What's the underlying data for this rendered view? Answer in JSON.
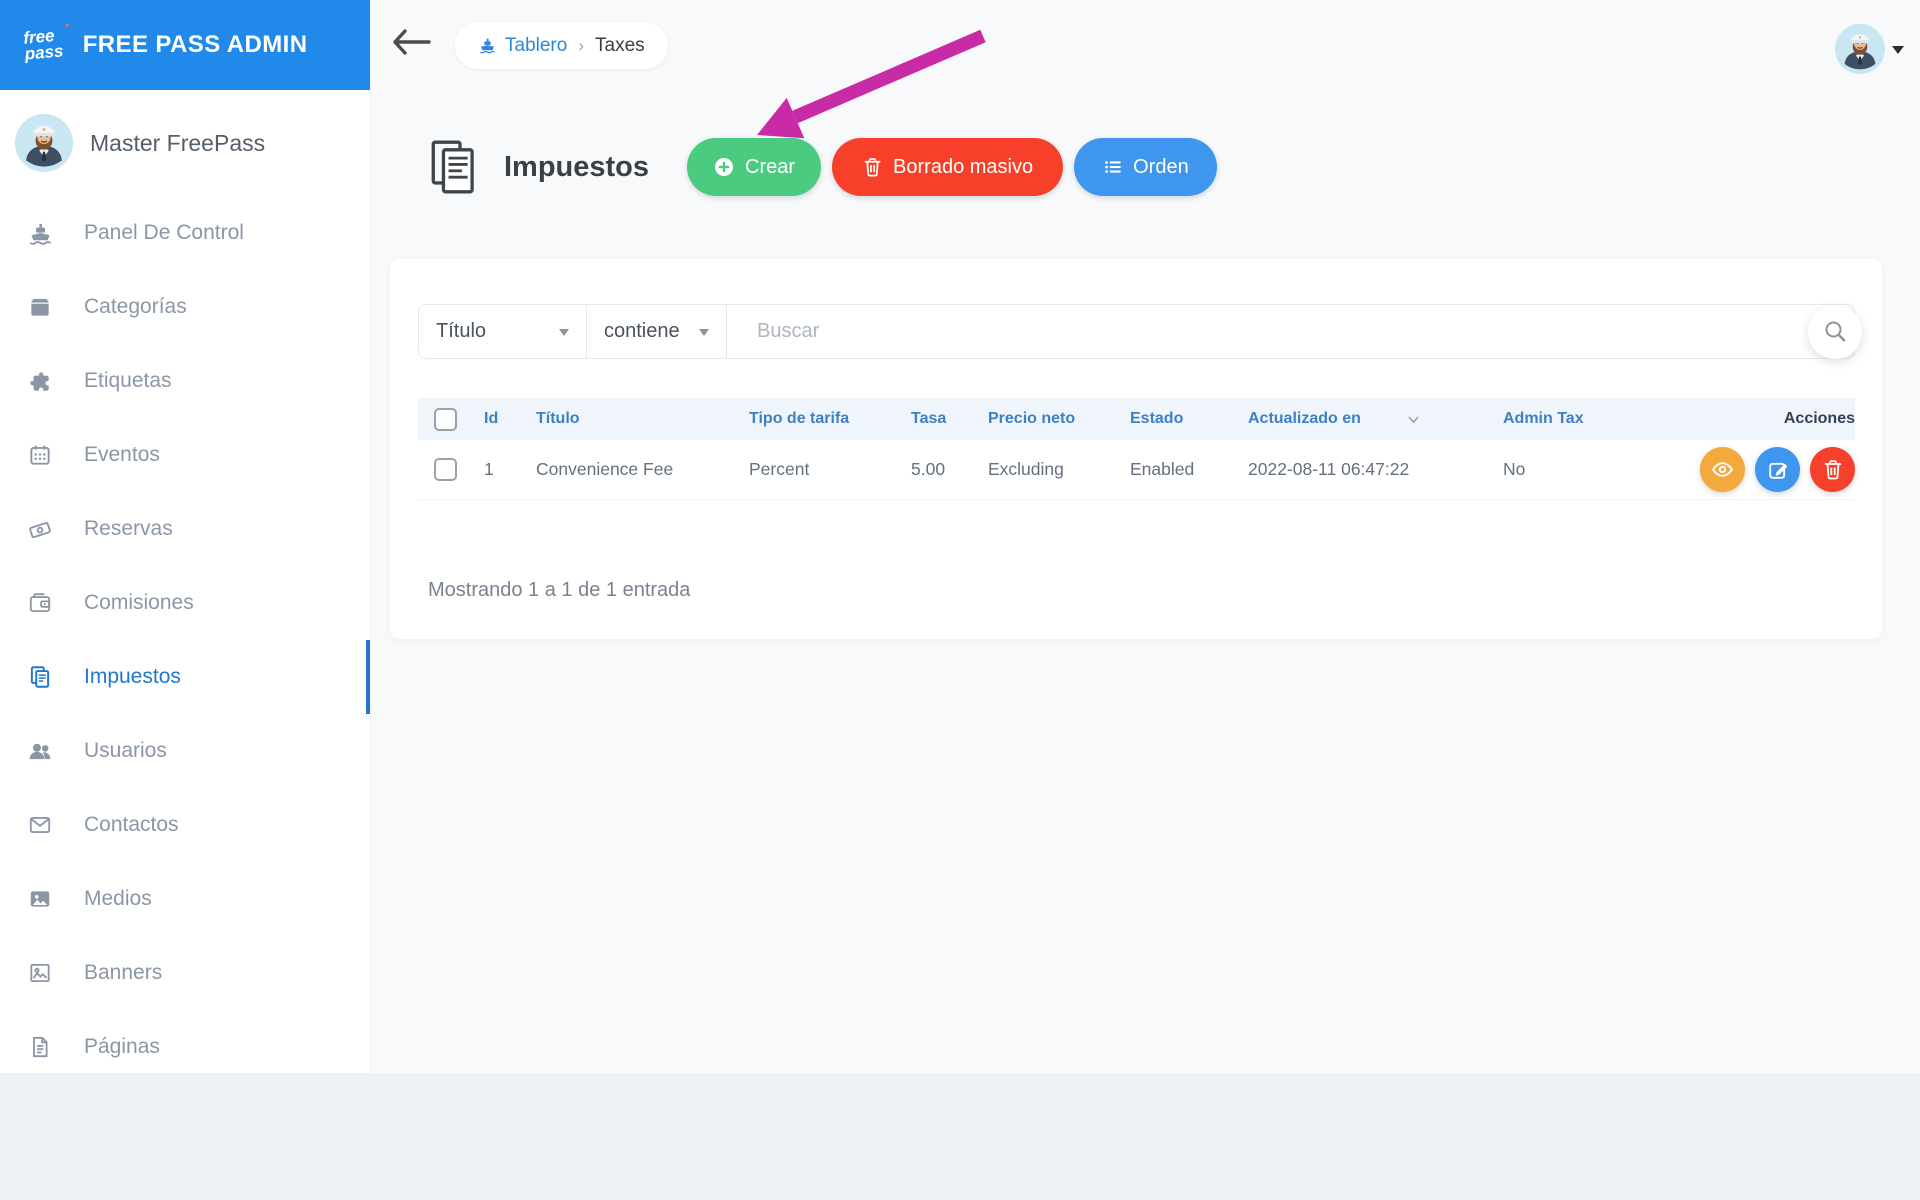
{
  "brand": {
    "logo_top": "free",
    "logo_bottom": "pass",
    "title": "FREE PASS ADMIN"
  },
  "profile": {
    "name": "Master FreePass"
  },
  "sidebar": {
    "items": [
      {
        "label": "Panel De Control"
      },
      {
        "label": "Categorías"
      },
      {
        "label": "Etiquetas"
      },
      {
        "label": "Eventos"
      },
      {
        "label": "Reservas"
      },
      {
        "label": "Comisiones"
      },
      {
        "label": "Impuestos"
      },
      {
        "label": "Usuarios"
      },
      {
        "label": "Contactos"
      },
      {
        "label": "Medios"
      },
      {
        "label": "Banners"
      },
      {
        "label": "Páginas"
      }
    ],
    "active_item": "Impuestos"
  },
  "breadcrumb": {
    "home": "Tablero",
    "separator": "›",
    "current": "Taxes"
  },
  "page": {
    "title": "Impuestos"
  },
  "toolbar": {
    "create": "Crear",
    "bulk_delete": "Borrado masivo",
    "order": "Orden"
  },
  "filter": {
    "field_selected": "Título",
    "operator_selected": "contiene",
    "search_placeholder": "Buscar",
    "search_value": ""
  },
  "table": {
    "headers": {
      "id": "Id",
      "title": "Título",
      "rate_type": "Tipo de tarifa",
      "rate": "Tasa",
      "net_price": "Precio neto",
      "status": "Estado",
      "updated_at": "Actualizado en",
      "admin_tax": "Admin Tax",
      "actions": "Acciones"
    },
    "rows": [
      {
        "id": "1",
        "title": "Convenience Fee",
        "rate_type": "Percent",
        "rate": "5.00",
        "net_price": "Excluding",
        "status": "Enabled",
        "updated_at": "2022-08-11 06:47:22",
        "admin_tax": "No"
      }
    ]
  },
  "summary": {
    "text": "Mostrando 1 a 1 de 1 entrada"
  },
  "colors": {
    "brand_blue": "#2189e9",
    "active_blue": "#2077cd",
    "create_green": "#4bcb80",
    "delete_red": "#f7402a",
    "order_blue": "#3e96ee",
    "view_orange": "#f3a93c",
    "arrow_magenta": "#c92ba6",
    "table_header_blue": "#3f80c4"
  }
}
